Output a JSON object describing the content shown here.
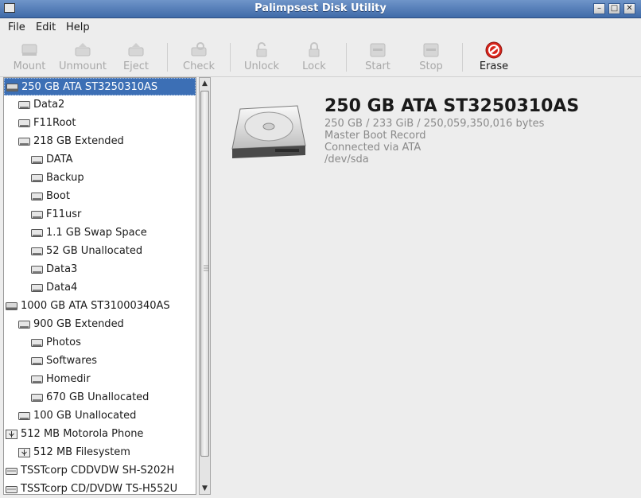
{
  "window": {
    "title": "Palimpsest Disk Utility"
  },
  "menu": {
    "file": "File",
    "edit": "Edit",
    "help": "Help"
  },
  "toolbar": {
    "mount": "Mount",
    "unmount": "Unmount",
    "eject": "Eject",
    "check": "Check",
    "unlock": "Unlock",
    "lock": "Lock",
    "start": "Start",
    "stop": "Stop",
    "erase": "Erase"
  },
  "tree": [
    {
      "label": "250 GB ATA ST3250310AS",
      "icon": "harddisk-icon",
      "selected": true
    },
    {
      "label": "Data2",
      "icon": "volume-icon"
    },
    {
      "label": "F11Root",
      "icon": "volume-icon"
    },
    {
      "label": "218 GB Extended",
      "icon": "volume-icon"
    },
    {
      "label": "DATA",
      "icon": "volume-icon"
    },
    {
      "label": "Backup",
      "icon": "volume-icon"
    },
    {
      "label": "Boot",
      "icon": "volume-icon"
    },
    {
      "label": "F11usr",
      "icon": "volume-icon"
    },
    {
      "label": "1.1 GB Swap Space",
      "icon": "volume-icon"
    },
    {
      "label": "52 GB Unallocated",
      "icon": "volume-icon"
    },
    {
      "label": "Data3",
      "icon": "volume-icon"
    },
    {
      "label": "Data4",
      "icon": "volume-icon"
    },
    {
      "label": "1000 GB ATA ST31000340AS",
      "icon": "harddisk-icon"
    },
    {
      "label": "900 GB Extended",
      "icon": "volume-icon"
    },
    {
      "label": "Photos",
      "icon": "volume-icon"
    },
    {
      "label": "Softwares",
      "icon": "volume-icon"
    },
    {
      "label": "Homedir",
      "icon": "volume-icon"
    },
    {
      "label": "670 GB Unallocated",
      "icon": "volume-icon"
    },
    {
      "label": "100 GB Unallocated",
      "icon": "volume-icon"
    },
    {
      "label": "512 MB Motorola Phone",
      "icon": "usb-icon"
    },
    {
      "label": "512 MB Filesystem",
      "icon": "usb-icon"
    },
    {
      "label": "TSSTcorp CDDVDW SH-S202H",
      "icon": "optical-drive-icon"
    },
    {
      "label": "TSSTcorp CD/DVDW TS-H552U",
      "icon": "optical-drive-icon"
    }
  ],
  "detail": {
    "title": "250 GB ATA ST3250310AS",
    "size": "250 GB / 233 GiB / 250,059,350,016 bytes",
    "partitioning": "Master Boot Record",
    "connection": "Connected via ATA",
    "device": "/dev/sda"
  }
}
